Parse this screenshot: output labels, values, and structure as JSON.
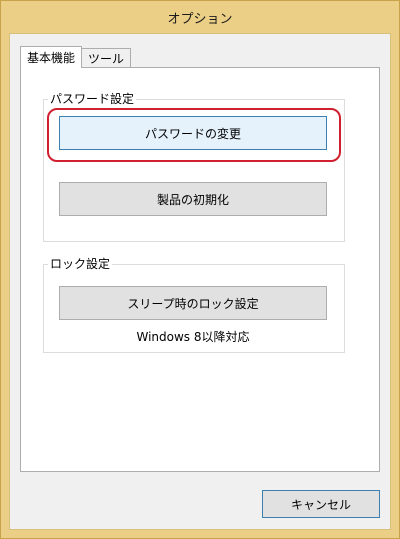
{
  "window": {
    "title": "オプション"
  },
  "tabs": [
    {
      "label": "基本機能",
      "active": true
    },
    {
      "label": "ツール",
      "active": false
    }
  ],
  "password_group": {
    "legend": "パスワード設定",
    "change_password_button": "パスワードの変更",
    "factory_reset_button": "製品の初期化"
  },
  "lock_group": {
    "legend": "ロック設定",
    "sleep_lock_button": "スリープ時のロック設定",
    "note": "Windows 8以降対応"
  },
  "footer": {
    "cancel_button": "キャンセル"
  },
  "colors": {
    "highlight": "#d02030",
    "title_bar": "#ebcf86"
  }
}
